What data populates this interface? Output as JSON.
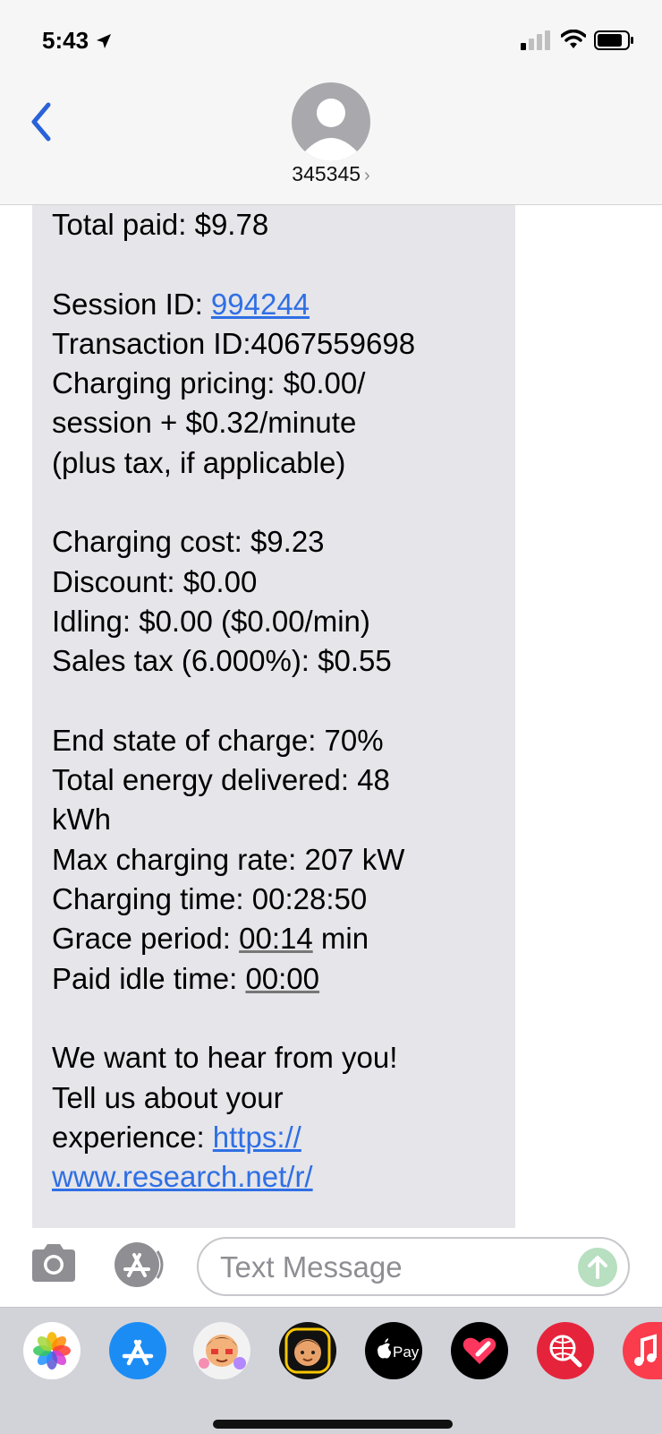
{
  "status_bar": {
    "time": "5:43"
  },
  "header": {
    "contact": "345345",
    "chevron": "›"
  },
  "message": {
    "lines": [
      "Total paid: $9.78",
      "",
      "Session ID: ",
      "Transaction ID:4067559698",
      "Charging pricing: $0.00/",
      "session + $0.32/minute",
      "(plus tax, if applicable)",
      "",
      "Charging cost: $9.23",
      "Discount: $0.00",
      "Idling: $0.00 ($0.00/min)",
      "Sales tax (6.000%): $0.55",
      "",
      "End state of charge: 70%",
      "Total energy delivered: 48",
      "kWh",
      "Max charging rate: 207 kW",
      "Charging time: 00:28:50",
      "Grace period: ",
      "Paid idle time: ",
      "",
      "We want to hear from you!",
      "Tell us about your",
      "experience: "
    ],
    "session_id": "994244",
    "grace_value": "00:14",
    "grace_unit": " min",
    "idle_value": "00:00",
    "survey_link_1": "https://",
    "survey_link_2": "www.research.net/r/"
  },
  "composer": {
    "placeholder": "Text Message"
  },
  "app_strip": {
    "apps": [
      "photos-app-icon",
      "app-store-app-icon",
      "memoji-app-icon",
      "memoji-camera-app-icon",
      "apple-pay-app-icon",
      "digital-touch-app-icon",
      "web-search-app-icon",
      "music-app-icon"
    ],
    "apple_pay_label": "Pay"
  },
  "colors": {
    "bubble": "#e5e5ea",
    "link": "#2f6fe4",
    "back_chevron": "#2a62d8",
    "send_button": "#b7dfc0"
  }
}
